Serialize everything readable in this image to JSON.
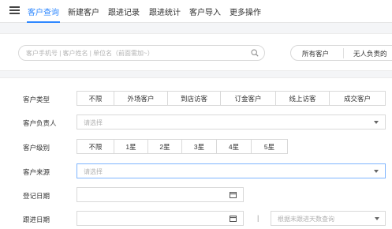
{
  "nav": {
    "tabs": [
      {
        "label": "客户查询",
        "active": true
      },
      {
        "label": "新建客户",
        "active": false
      },
      {
        "label": "跟进记录",
        "active": false
      },
      {
        "label": "跟进统计",
        "active": false
      },
      {
        "label": "客户导入",
        "active": false
      },
      {
        "label": "更多操作",
        "active": false
      }
    ]
  },
  "search": {
    "placeholder": "客户手机号 | 客户姓名 | 单位名（前面需加~）",
    "filters": [
      "所有客户",
      "无人负责的"
    ]
  },
  "form": {
    "customer_type": {
      "label": "客户类型",
      "options": [
        "不限",
        "外场客户",
        "到店访客",
        "订金客户",
        "线上访客",
        "成交客户"
      ]
    },
    "owner": {
      "label": "客户负责人",
      "placeholder": "请选择"
    },
    "level": {
      "label": "客户级别",
      "options": [
        "不限",
        "1星",
        "2星",
        "3星",
        "4星",
        "5星"
      ]
    },
    "source": {
      "label": "客户来源",
      "placeholder": "请选择"
    },
    "register_date": {
      "label": "登记日期"
    },
    "follow_date": {
      "label": "跟进日期",
      "separator": "|",
      "days_placeholder": "根据未跟进天数查询"
    }
  },
  "colors": {
    "accent": "#2f88ff",
    "border": "#d9d9d9",
    "band": "#f4f5f7"
  }
}
